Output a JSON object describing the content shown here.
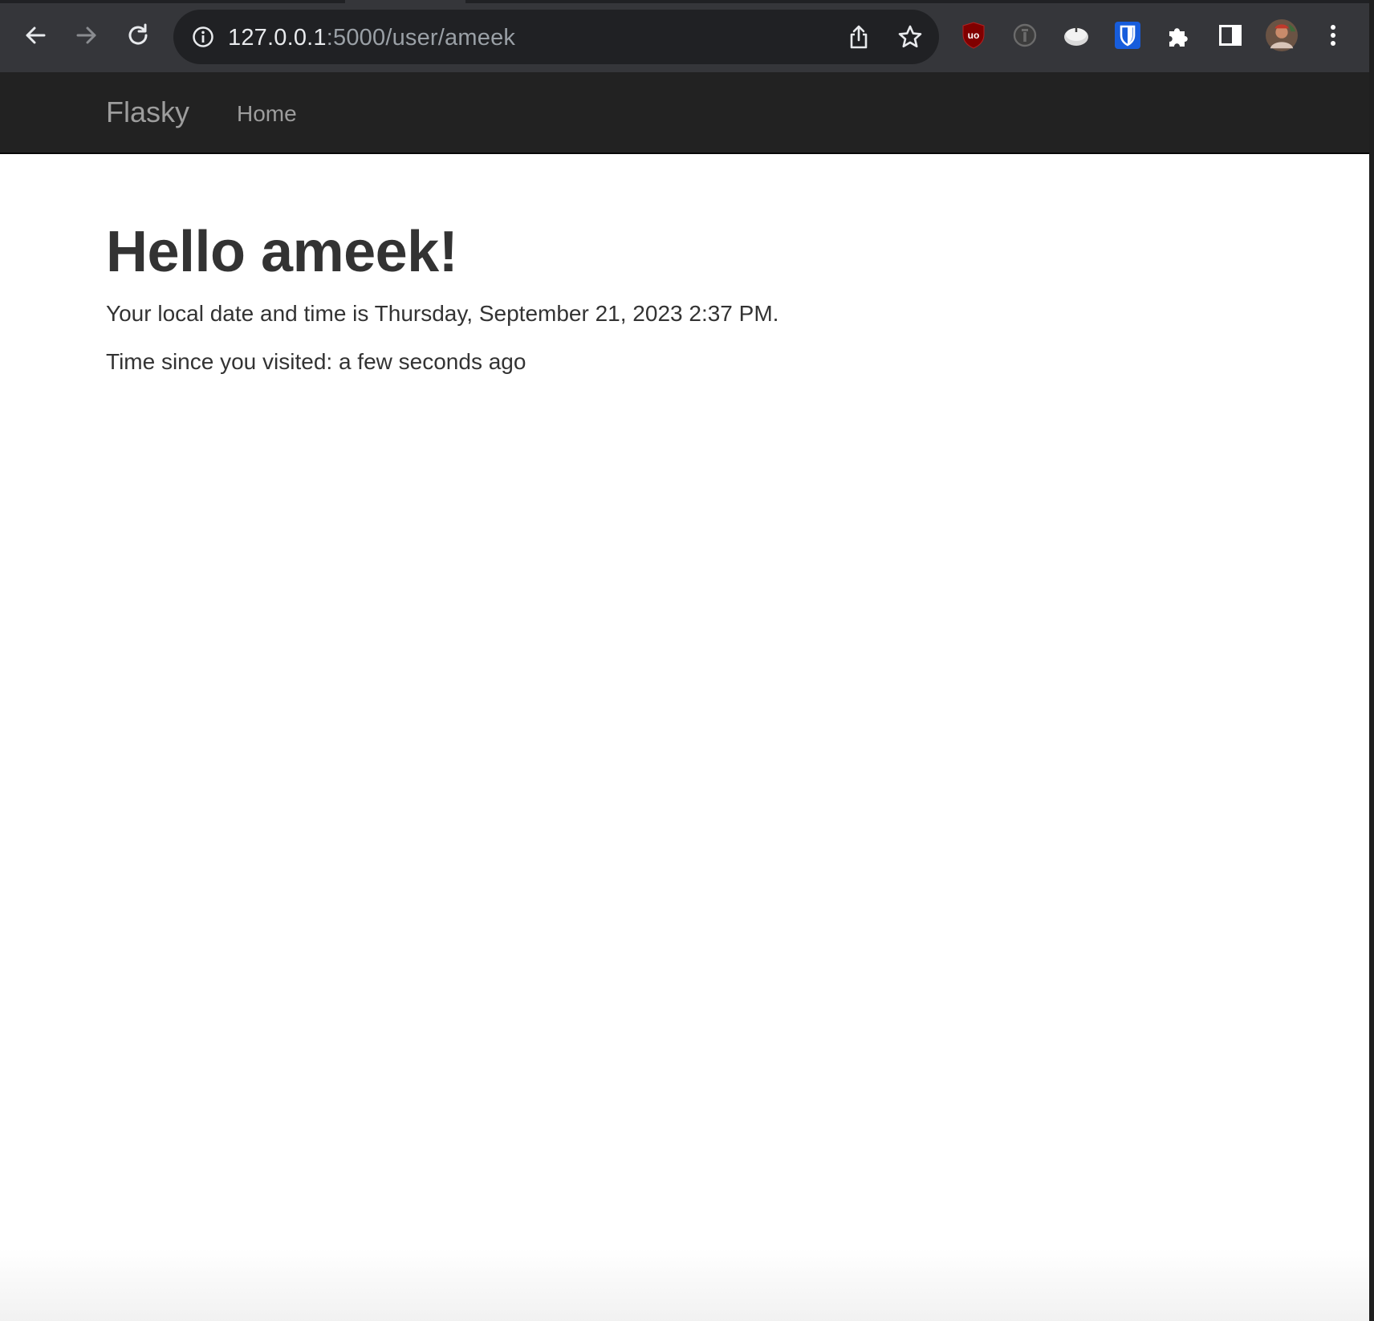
{
  "browser": {
    "address_bar": {
      "host": "127.0.0.1",
      "path": ":5000/user/ameek"
    },
    "toolbar_icons": {
      "back": "arrow-left-icon",
      "forward": "arrow-right-icon",
      "reload": "reload-icon",
      "site_info": "info-icon",
      "share": "share-icon",
      "bookmark": "star-icon"
    },
    "extensions": [
      {
        "name": "ublock-icon",
        "label": "uo",
        "color": "#800000"
      },
      {
        "name": "info-extension-icon",
        "color": "#6b6b6b"
      },
      {
        "name": "cookie-extension-icon",
        "color": "#d9d9d9"
      },
      {
        "name": "bitwarden-icon",
        "color": "#175ddc"
      },
      {
        "name": "puzzle-icon",
        "color": "#ffffff"
      },
      {
        "name": "side-panel-icon",
        "color": "#ffffff"
      },
      {
        "name": "profile-avatar",
        "color": "#8a5a44"
      },
      {
        "name": "menu-kebab-icon",
        "color": "#ffffff"
      }
    ]
  },
  "navbar": {
    "brand": "Flasky",
    "links": [
      {
        "label": "Home"
      }
    ],
    "background": "#222222",
    "link_color": "#9d9d9d"
  },
  "content": {
    "heading": "Hello ameek!",
    "datetime_line": "Your local date and time is Thursday, September 21, 2023 2:37 PM.",
    "visit_line": "Time since you visited: a few seconds ago",
    "text_color": "#333333"
  }
}
